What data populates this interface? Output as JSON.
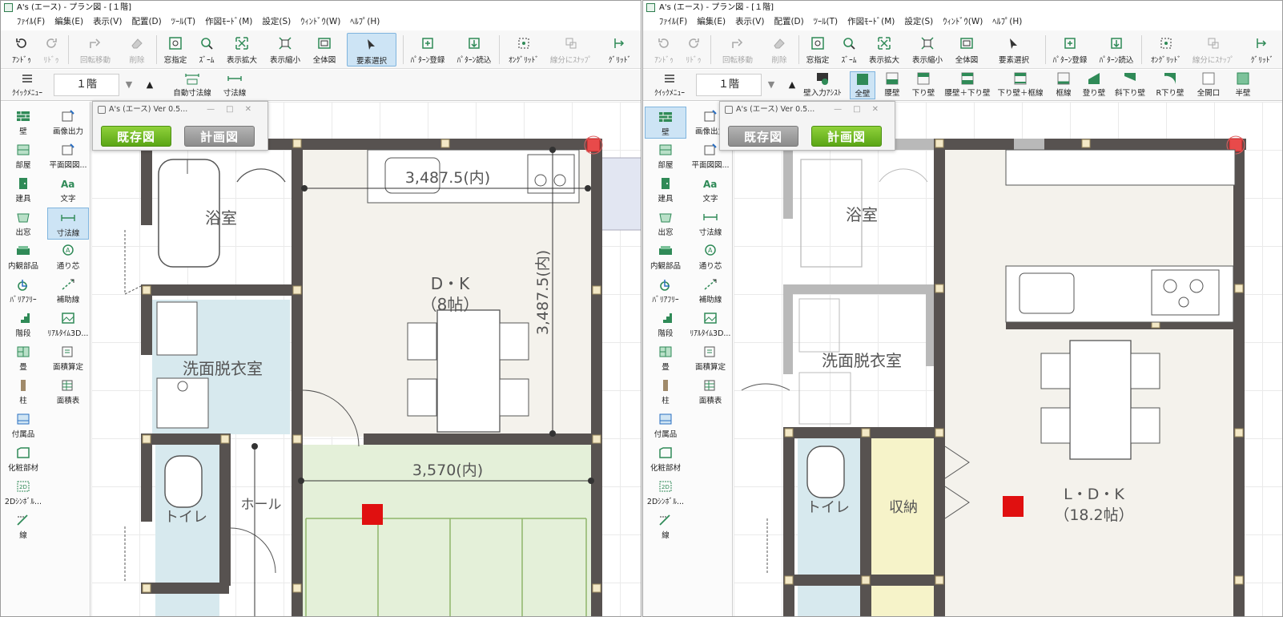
{
  "left": {
    "title": "A's (エース) - プラン図 - [１階]",
    "menu": [
      "ﾌｧｲﾙ(F)",
      "編集(E)",
      "表示(V)",
      "配置(D)",
      "ﾂｰﾙ(T)",
      "作図ﾓｰﾄﾞ(M)",
      "設定(S)",
      "ｳｨﾝﾄﾞｳ(W)",
      "ﾍﾙﾌﾟ(H)"
    ],
    "toolbar": {
      "undo": "ｱﾝﾄﾞｩ",
      "redo": "ﾘﾄﾞｩ",
      "rotate_move": "回転移動",
      "delete": "削除",
      "window_select": "窓指定",
      "zoom": "ｽﾞｰﾑ",
      "zoom_in": "表示拡大",
      "zoom_out": "表示縮小",
      "full_view": "全体図",
      "element_select": "要素選択",
      "pattern_register": "ﾊﾟﾀｰﾝ登録",
      "pattern_load": "ﾊﾟﾀｰﾝ読込",
      "on_grid": "ｵﾝｸﾞﾘｯﾄﾞ",
      "segment_snap": "線分にｽﾅｯﾌﾟ",
      "grid": "ｸﾞﾘｯﾄﾞ"
    },
    "toolbar2": {
      "quick_menu": "ｸｲｯｸﾒﾆｭｰ",
      "floor": "１階",
      "auto_dimension": "自動寸法線",
      "dimension": "寸法線"
    },
    "sidebar": [
      "壁",
      "画像出力",
      "部屋",
      "平面図図...",
      "建具",
      "文字",
      "出窓",
      "寸法線",
      "内観部品",
      "通り芯",
      "ﾊﾞﾘｱﾌﾘｰ",
      "補助線",
      "階段",
      "ﾘｱﾙﾀｲﾑ3D...",
      "畳",
      "面積算定",
      "柱",
      "面積表",
      "付属品",
      "化粧部材",
      "2Dｼﾝﾎﾞﾙ...",
      "線"
    ],
    "popup": {
      "title": "A's (エース) Ver 0.5...",
      "existing": "既存図",
      "plan": "計画図"
    },
    "rooms": {
      "bath": "浴室",
      "dk": "D・K",
      "dk_size": "（8帖）",
      "washroom": "洗面脱衣室",
      "toilet": "トイレ",
      "hall": "ホール"
    },
    "dims": {
      "top": "3,487.5(内)",
      "vertical": "3,487.5(内)",
      "lower": "3,570(内)"
    }
  },
  "right": {
    "title": "A's (エース) - プラン図 - [１階]",
    "menu": [
      "ﾌｧｲﾙ(F)",
      "編集(E)",
      "表示(V)",
      "配置(D)",
      "ﾂｰﾙ(T)",
      "作図ﾓｰﾄﾞ(M)",
      "設定(S)",
      "ｳｨﾝﾄﾞｳ(W)",
      "ﾍﾙﾌﾟ(H)"
    ],
    "toolbar": {
      "undo": "ｱﾝﾄﾞｩ",
      "redo": "ﾘﾄﾞｩ",
      "rotate_move": "回転移動",
      "delete": "削除",
      "window_select": "窓指定",
      "zoom": "ｽﾞｰﾑ",
      "zoom_in": "表示拡大",
      "zoom_out": "表示縮小",
      "full_view": "全体図",
      "element_select": "要素選択",
      "pattern_register": "ﾊﾟﾀｰﾝ登録",
      "pattern_load": "ﾊﾟﾀｰﾝ読込",
      "on_grid": "ｵﾝｸﾞﾘｯﾄﾞ",
      "segment_snap": "線分にｽﾅｯﾌﾟ",
      "grid": "ｸﾞﾘｯﾄﾞ"
    },
    "toolbar2": {
      "quick_menu": "ｸｲｯｸﾒﾆｭｰ",
      "floor": "１階",
      "wall_assist": "壁入力ｱｼｽﾄ",
      "walls": [
        "全壁",
        "腰壁",
        "下り壁",
        "腰壁＋下り壁",
        "下り壁＋框線",
        "框線",
        "登り壁",
        "斜下り壁",
        "R下り壁",
        "全開口",
        "半壁"
      ]
    },
    "sidebar": [
      "壁",
      "画像出力",
      "部屋",
      "平面図図...",
      "建具",
      "文字",
      "出窓",
      "寸法線",
      "内観部品",
      "通り芯",
      "ﾊﾞﾘｱﾌﾘｰ",
      "補助線",
      "階段",
      "ﾘｱﾙﾀｲﾑ3D...",
      "畳",
      "面積算定",
      "柱",
      "面積表",
      "付属品",
      "化粧部材",
      "2Dｼﾝﾎﾞﾙ...",
      "線"
    ],
    "popup": {
      "title": "A's (エース) Ver 0.5...",
      "existing": "既存図",
      "plan": "計画図"
    },
    "rooms": {
      "bath": "浴室",
      "washroom": "洗面脱衣室",
      "toilet": "トイレ",
      "storage": "収納",
      "ldk": "L・D・K",
      "ldk_size": "（18.2帖）"
    }
  },
  "colors": {
    "wall": "#575250",
    "accent_green": "#2f8a57",
    "selected_blue": "#cde4f5",
    "washroom_fill": "#d7e9ee",
    "tatami_fill": "#e4f0d9",
    "storage_fill": "#f6f3c9",
    "marker_red": "#e01010"
  }
}
